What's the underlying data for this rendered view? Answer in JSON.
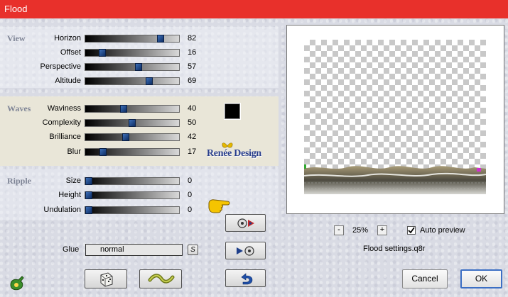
{
  "window": {
    "title": "Flood"
  },
  "view": {
    "label": "View",
    "rows": [
      {
        "label": "Horizon",
        "value": 82
      },
      {
        "label": "Offset",
        "value": 16
      },
      {
        "label": "Perspective",
        "value": 57
      },
      {
        "label": "Altitude",
        "value": 69
      }
    ]
  },
  "waves": {
    "label": "Waves",
    "color": "#000000",
    "rows": [
      {
        "label": "Waviness",
        "value": 40
      },
      {
        "label": "Complexity",
        "value": 50
      },
      {
        "label": "Brilliance",
        "value": 42
      },
      {
        "label": "Blur",
        "value": 17
      }
    ]
  },
  "ripple": {
    "label": "Ripple",
    "rows": [
      {
        "label": "Size",
        "value": 0
      },
      {
        "label": "Height",
        "value": 0
      },
      {
        "label": "Undulation",
        "value": 0
      }
    ]
  },
  "watermark": "Renée Design",
  "glue": {
    "label": "Glue",
    "value": "normal",
    "menu_button": "S"
  },
  "preview": {
    "zoom": "25%",
    "zoom_out": "-",
    "zoom_in": "+",
    "auto_preview_label": "Auto preview",
    "auto_preview_checked": true,
    "settings_file": "Flood settings.q8r"
  },
  "buttons": {
    "cancel": "Cancel",
    "ok": "OK"
  },
  "icons": {
    "logo": "plugin-logo-icon",
    "random": "dice-icon",
    "reset": "wave-icon",
    "undo": "undo-arrow-icon",
    "save_preset": "save-preset-icon",
    "load_preset": "load-preset-icon",
    "pointer": "pointing-hand-icon"
  }
}
